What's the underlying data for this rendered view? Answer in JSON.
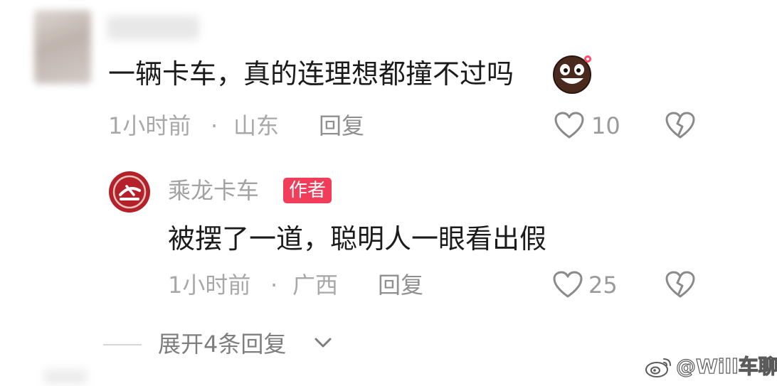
{
  "comment": {
    "text": "一辆卡车，真的连理想都撞不过吗",
    "time": "1小时前",
    "separator": "·",
    "location": "山东",
    "reply_label": "回复",
    "like_count": "10",
    "emoji_icon": "smiling-face-emoji-icon"
  },
  "reply": {
    "author_name": "乘龙卡车",
    "author_badge": "作者",
    "text": "被摆了一道，聪明人一眼看出假",
    "time": "1小时前",
    "separator": "·",
    "location": "广西",
    "reply_label": "回复",
    "like_count": "25"
  },
  "expand": {
    "label": "展开4条回复"
  },
  "watermark": {
    "text": "@Will车聊"
  },
  "colors": {
    "badge": "#f23d5a",
    "meta_text": "#a8a8a8",
    "author_avatar": "#b5212a"
  }
}
